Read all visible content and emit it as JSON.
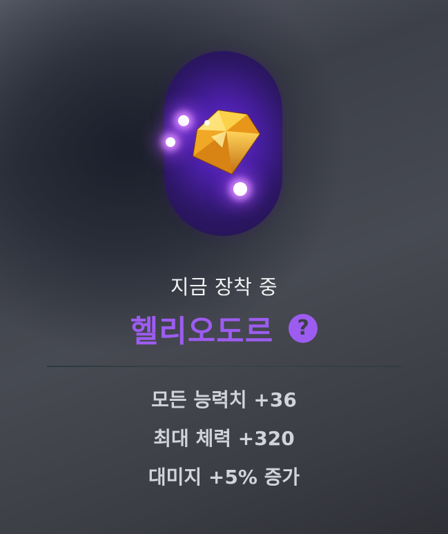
{
  "equipped": {
    "status_label": "지금 장착 중",
    "item_name": "헬리오도르",
    "help_symbol": "?",
    "icon": "yellow-gem-icon",
    "name_color": "#9d5cf0"
  },
  "stats": [
    "모든 능력치 +36",
    "최대 체력 +320",
    "대미지 +5% 증가"
  ]
}
